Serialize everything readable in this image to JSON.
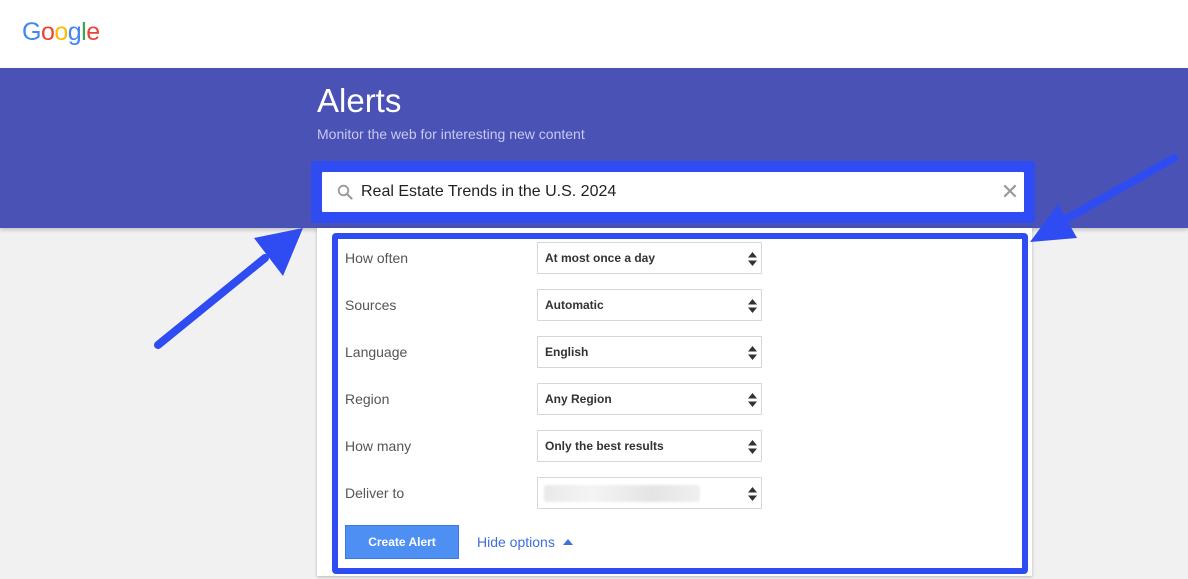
{
  "logo": {
    "letters": [
      "G",
      "o",
      "o",
      "g",
      "l",
      "e"
    ],
    "colors": [
      "#4285F4",
      "#EA4335",
      "#FBBC05",
      "#4285F4",
      "#34A853",
      "#EA4335"
    ]
  },
  "hero": {
    "title": "Alerts",
    "subtitle": "Monitor the web for interesting new content"
  },
  "search": {
    "value": "Real Estate Trends in the U.S. 2024",
    "icon": "search-icon",
    "clear_icon": "close-icon"
  },
  "options": [
    {
      "label": "How often",
      "value": "At most once a day"
    },
    {
      "label": "Sources",
      "value": "Automatic"
    },
    {
      "label": "Language",
      "value": "English"
    },
    {
      "label": "Region",
      "value": "Any Region"
    },
    {
      "label": "How many",
      "value": "Only the best results"
    },
    {
      "label": "Deliver to",
      "value": ""
    }
  ],
  "actions": {
    "create_label": "Create Alert",
    "hide_label": "Hide options"
  },
  "colors": {
    "hero": "#4a52b6",
    "highlight": "#2e4cf2",
    "button": "#4d8ff2",
    "link": "#3e6fd8"
  }
}
